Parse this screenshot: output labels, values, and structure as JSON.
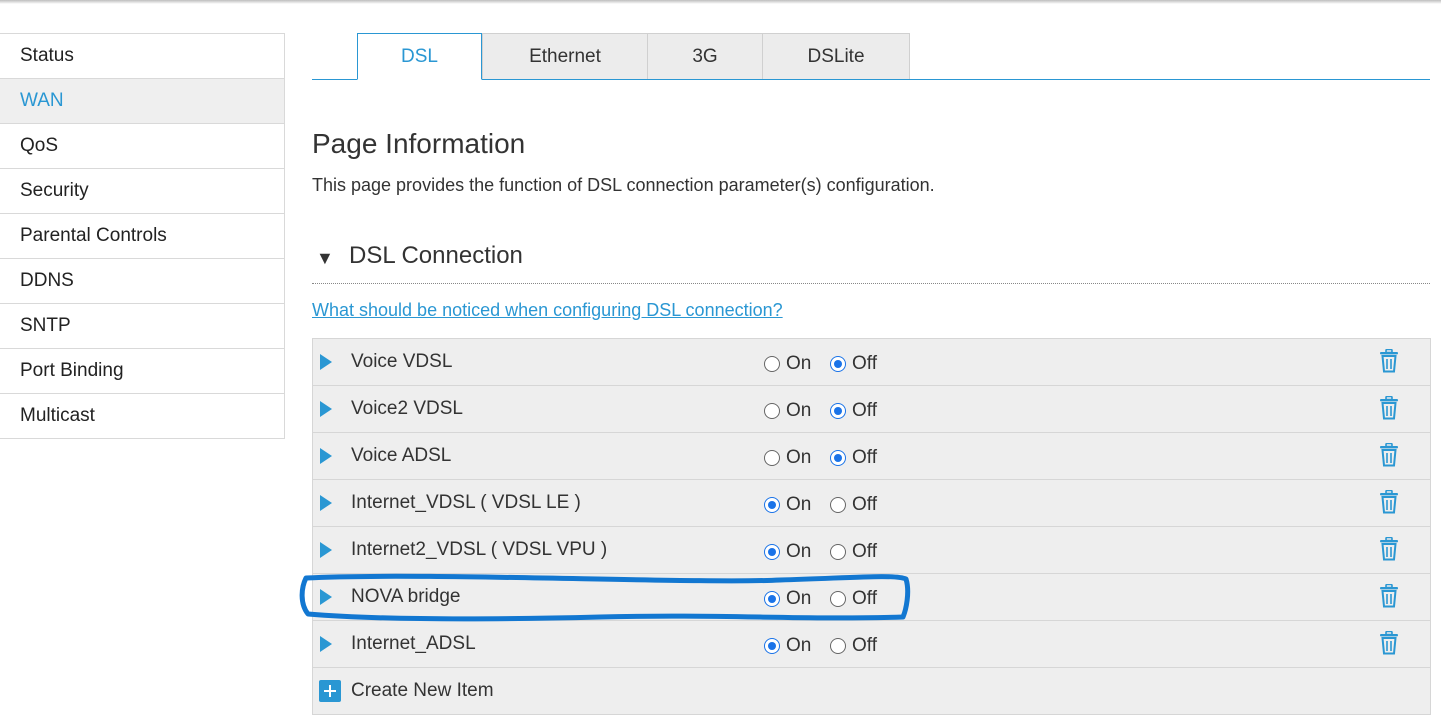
{
  "sidebar": {
    "items": [
      {
        "label": "Status",
        "active": false
      },
      {
        "label": "WAN",
        "active": true
      },
      {
        "label": "QoS",
        "active": false
      },
      {
        "label": "Security",
        "active": false
      },
      {
        "label": "Parental Controls",
        "active": false
      },
      {
        "label": "DDNS",
        "active": false
      },
      {
        "label": "SNTP",
        "active": false
      },
      {
        "label": "Port Binding",
        "active": false
      },
      {
        "label": "Multicast",
        "active": false
      }
    ]
  },
  "tabs": [
    {
      "label": "DSL",
      "active": true
    },
    {
      "label": "Ethernet",
      "active": false
    },
    {
      "label": "3G",
      "active": false
    },
    {
      "label": "DSLite",
      "active": false
    }
  ],
  "page": {
    "title": "Page Information",
    "description": "This page provides the function of DSL connection parameter(s) configuration."
  },
  "section": {
    "arrow": "▼",
    "title": "DSL Connection",
    "help_link": "What should be noticed when configuring DSL connection?"
  },
  "radio_labels": {
    "on": "On",
    "off": "Off"
  },
  "connections": [
    {
      "name": "Voice VDSL",
      "state": "off"
    },
    {
      "name": "Voice2 VDSL",
      "state": "off"
    },
    {
      "name": "Voice ADSL",
      "state": "off"
    },
    {
      "name": "Internet_VDSL ( VDSL LE )",
      "state": "on"
    },
    {
      "name": "Internet2_VDSL ( VDSL VPU )",
      "state": "on"
    },
    {
      "name": "NOVA bridge",
      "state": "on"
    },
    {
      "name": "Internet_ADSL",
      "state": "on"
    }
  ],
  "create_item": {
    "label": "Create New Item"
  },
  "colors": {
    "accent": "#2a97d3",
    "radio": "#1a73e8",
    "annotation": "#1277d1"
  },
  "icons": {
    "expand": "expand-arrow-icon",
    "delete": "trash-icon",
    "create": "plus-icon"
  }
}
